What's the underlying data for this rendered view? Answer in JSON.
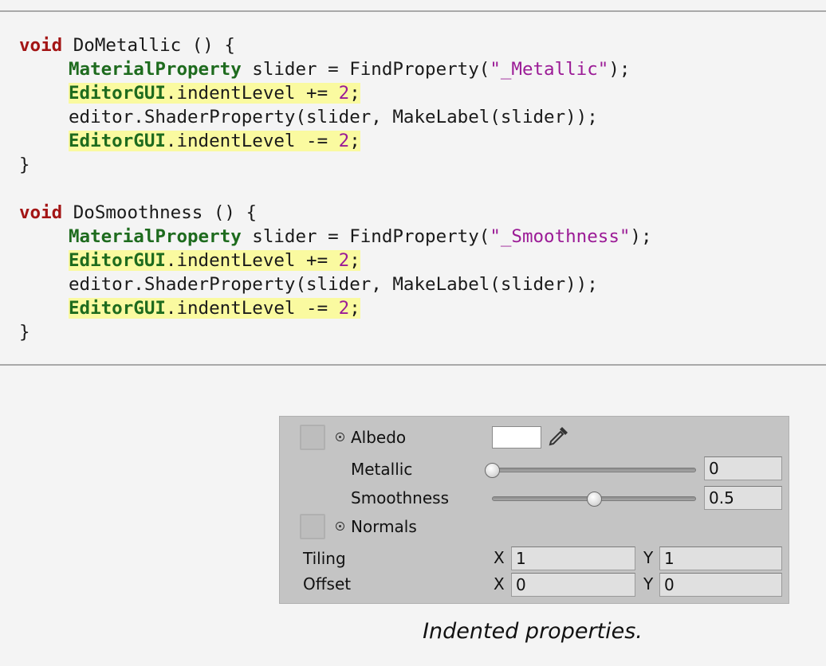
{
  "code": {
    "lines": [
      [
        {
          "t": "void",
          "c": "kw"
        },
        {
          "t": " DoMetallic () {",
          "c": ""
        }
      ],
      [
        {
          "ind": true
        },
        {
          "t": "MaterialProperty",
          "c": "ty"
        },
        {
          "t": " slider = FindProperty(",
          "c": ""
        },
        {
          "t": "\"_Metallic\"",
          "c": "str"
        },
        {
          "t": ");",
          "c": ""
        }
      ],
      [
        {
          "ind": true
        },
        {
          "t": "EditorGUI",
          "c": "ty hl"
        },
        {
          "t": ".indentLevel += ",
          "c": "hl"
        },
        {
          "t": "2",
          "c": "num hl"
        },
        {
          "t": ";",
          "c": "hl"
        }
      ],
      [
        {
          "ind": true
        },
        {
          "t": "editor.ShaderProperty(slider, MakeLabel(slider));",
          "c": ""
        }
      ],
      [
        {
          "ind": true
        },
        {
          "t": "EditorGUI",
          "c": "ty hl"
        },
        {
          "t": ".indentLevel -= ",
          "c": "hl"
        },
        {
          "t": "2",
          "c": "num hl"
        },
        {
          "t": ";",
          "c": "hl"
        }
      ],
      [
        {
          "t": "}",
          "c": ""
        }
      ],
      [],
      [
        {
          "t": "void",
          "c": "kw"
        },
        {
          "t": " DoSmoothness () {",
          "c": ""
        }
      ],
      [
        {
          "ind": true
        },
        {
          "t": "MaterialProperty",
          "c": "ty"
        },
        {
          "t": " slider = FindProperty(",
          "c": ""
        },
        {
          "t": "\"_Smoothness\"",
          "c": "str"
        },
        {
          "t": ");",
          "c": ""
        }
      ],
      [
        {
          "ind": true
        },
        {
          "t": "EditorGUI",
          "c": "ty hl"
        },
        {
          "t": ".indentLevel += ",
          "c": "hl"
        },
        {
          "t": "2",
          "c": "num hl"
        },
        {
          "t": ";",
          "c": "hl"
        }
      ],
      [
        {
          "ind": true
        },
        {
          "t": "editor.ShaderProperty(slider, MakeLabel(slider));",
          "c": ""
        }
      ],
      [
        {
          "ind": true
        },
        {
          "t": "EditorGUI",
          "c": "ty hl"
        },
        {
          "t": ".indentLevel -= ",
          "c": "hl"
        },
        {
          "t": "2",
          "c": "num hl"
        },
        {
          "t": ";",
          "c": "hl"
        }
      ],
      [
        {
          "t": "}",
          "c": ""
        }
      ]
    ]
  },
  "inspector": {
    "albedo_label": "Albedo",
    "metallic_label": "Metallic",
    "metallic_value": "0",
    "metallic_level": 0,
    "smoothness_label": "Smoothness",
    "smoothness_value": "0.5",
    "smoothness_level": 0.5,
    "normals_label": "Normals",
    "tiling_label": "Tiling",
    "offset_label": "Offset",
    "x_label": "X",
    "y_label": "Y",
    "tiling_x": "1",
    "tiling_y": "1",
    "offset_x": "0",
    "offset_y": "0",
    "albedo_color": "#ffffff",
    "eyedropper_icon": "eyedropper-icon"
  },
  "caption": "Indented properties."
}
